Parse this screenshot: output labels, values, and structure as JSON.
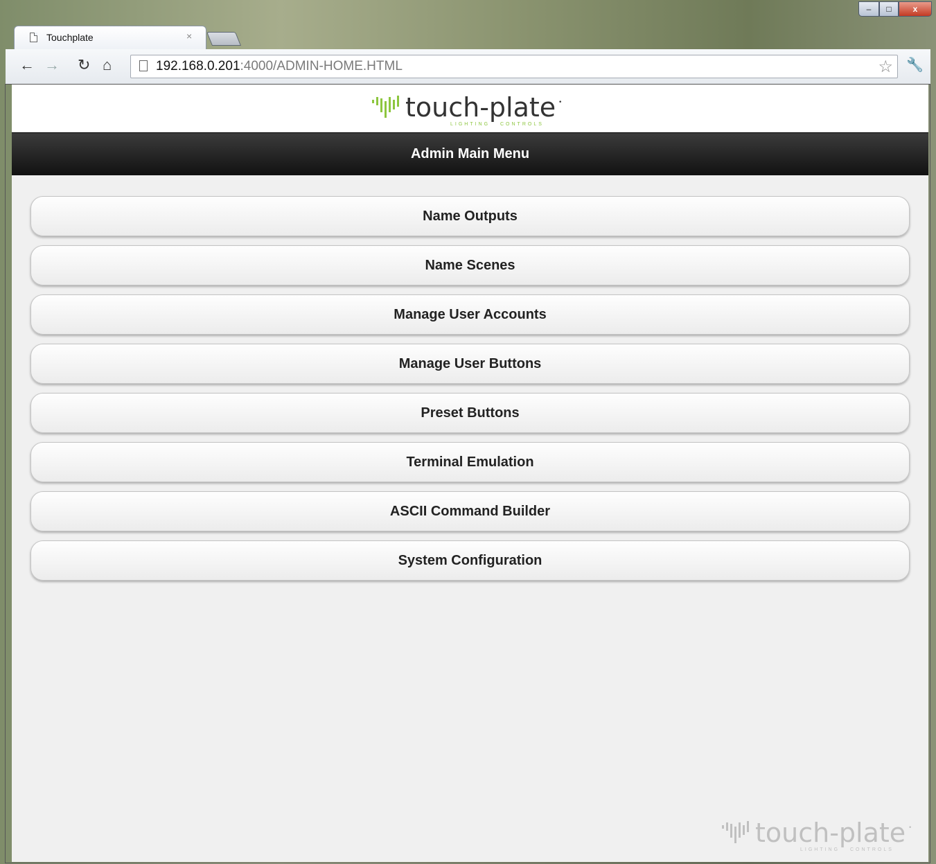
{
  "browser": {
    "tab_title": "Touchplate",
    "tab_close": "×",
    "url_host": "192.168.0.201",
    "url_path": ":4000/ADMIN-HOME.HTML",
    "window_controls": {
      "minimize": "–",
      "maximize": "□",
      "close": "x"
    },
    "icons": [
      "back-icon",
      "forward-icon",
      "reload-icon",
      "home-icon",
      "page-icon",
      "bookmark-star-icon",
      "wrench-icon"
    ]
  },
  "header": {
    "brand": "touch-plate",
    "brand_sub_left": "LIGHTING",
    "brand_sub_right": "CONTROLS",
    "title": "Admin Main Menu"
  },
  "menu": [
    {
      "label": "Name Outputs"
    },
    {
      "label": "Name Scenes"
    },
    {
      "label": "Manage User Accounts"
    },
    {
      "label": "Manage User Buttons"
    },
    {
      "label": "Preset Buttons"
    },
    {
      "label": "Terminal Emulation"
    },
    {
      "label": "ASCII Command Builder"
    },
    {
      "label": "System Configuration"
    }
  ],
  "colors": {
    "accent_green": "#8dc63f",
    "header_bar": "#1a1a1a",
    "page_bg": "#f0f0f0"
  }
}
